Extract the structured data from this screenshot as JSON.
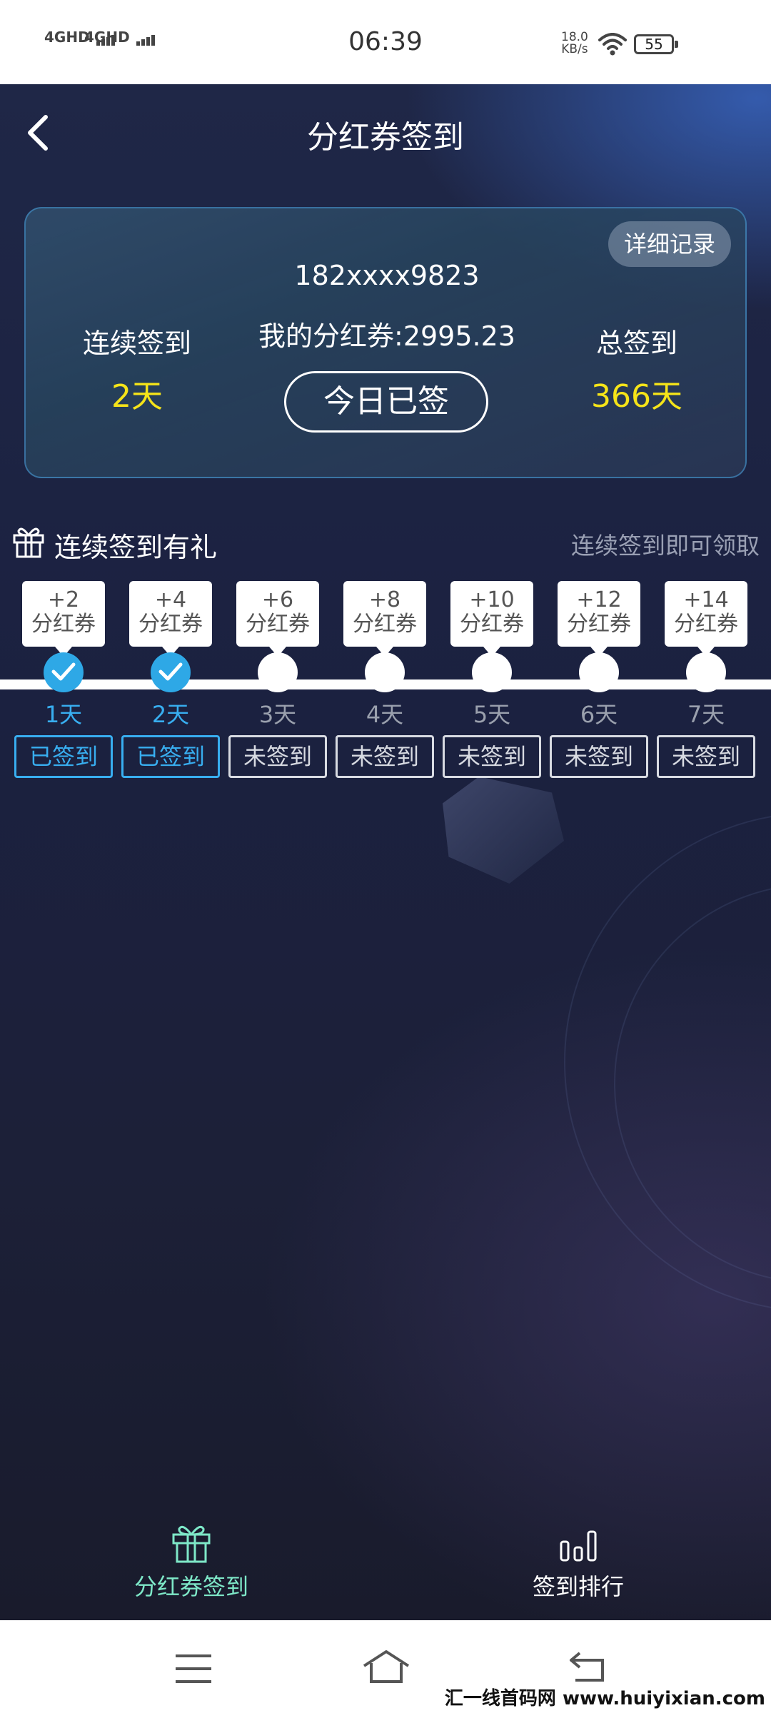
{
  "status_bar": {
    "signal_1": "4GHD",
    "signal_2": "4GHD",
    "time": "06:39",
    "speed_value": "18.0",
    "speed_unit": "KB/s",
    "battery": "55"
  },
  "nav": {
    "title": "分红券签到",
    "back_icon": "chevron-left-icon"
  },
  "card": {
    "detail_button": "详细记录",
    "phone": "182xxxx9823",
    "balance": "我的分红券:2995.23",
    "today_button": "今日已签",
    "consecutive_label": "连续签到",
    "consecutive_value": "2天",
    "total_label": "总签到",
    "total_value": "366天"
  },
  "section": {
    "icon": "gift-icon",
    "title": "连续签到有礼",
    "note": "连续签到即可领取"
  },
  "days": [
    {
      "reward": "+2",
      "unit": "分红券",
      "label": "1天",
      "status": "已签到",
      "signed": true
    },
    {
      "reward": "+4",
      "unit": "分红券",
      "label": "2天",
      "status": "已签到",
      "signed": true
    },
    {
      "reward": "+6",
      "unit": "分红券",
      "label": "3天",
      "status": "未签到",
      "signed": false
    },
    {
      "reward": "+8",
      "unit": "分红券",
      "label": "4天",
      "status": "未签到",
      "signed": false
    },
    {
      "reward": "+10",
      "unit": "分红券",
      "label": "5天",
      "status": "未签到",
      "signed": false
    },
    {
      "reward": "+12",
      "unit": "分红券",
      "label": "6天",
      "status": "未签到",
      "signed": false
    },
    {
      "reward": "+14",
      "unit": "分红券",
      "label": "7天",
      "status": "未签到",
      "signed": false
    }
  ],
  "tabs": [
    {
      "label": "分红券签到",
      "icon": "gift-icon",
      "active": true
    },
    {
      "label": "签到排行",
      "icon": "bar-chart-icon",
      "active": false
    }
  ],
  "system_nav": {
    "menu_icon": "menu-icon",
    "home_icon": "home-icon",
    "back_icon": "back-arrow-icon"
  },
  "watermark": "汇一线首码网  www.huiyixian.com",
  "colors": {
    "accent_blue": "#38aef0",
    "value_yellow": "#f5e419",
    "active_tab": "#7ee8c8",
    "inactive_tab": "#ffffff"
  }
}
